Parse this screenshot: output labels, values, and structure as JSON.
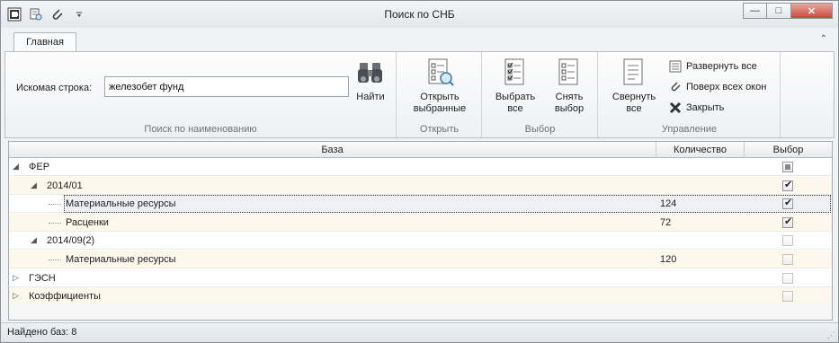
{
  "window": {
    "title": "Поиск по СНБ",
    "minimize_label": "—",
    "maximize_label": "□",
    "close_label": "✕"
  },
  "ribbon": {
    "tab_label": "Главная",
    "search_group": {
      "label": "Искомая строка:",
      "input_value": "железобет фунд",
      "find_label": "Найти",
      "group_label": "Поиск по наименованию"
    },
    "open_group": {
      "button_line1": "Открыть",
      "button_line2": "выбранные",
      "group_label": "Открыть"
    },
    "select_group": {
      "select_all_line1": "Выбрать",
      "select_all_line2": "все",
      "deselect_line1": "Снять",
      "deselect_line2": "выбор",
      "group_label": "Выбор"
    },
    "manage_group": {
      "collapse_line1": "Свернуть",
      "collapse_line2": "все",
      "expand_all": "Развернуть все",
      "on_top": "Поверх всех окон",
      "close": "Закрыть",
      "group_label": "Управление"
    }
  },
  "grid": {
    "columns": [
      "База",
      "Количество",
      "Выбор"
    ],
    "rows": [
      {
        "name": "ФЕР",
        "qty": "",
        "checked": "partial",
        "level": 0,
        "expanded": true
      },
      {
        "name": "2014/01",
        "qty": "",
        "checked": "on",
        "level": 1,
        "expanded": true
      },
      {
        "name": "Материальные ресурсы",
        "qty": "124",
        "checked": "on",
        "level": 2,
        "selected": true
      },
      {
        "name": "Расценки",
        "qty": "72",
        "checked": "on",
        "level": 2
      },
      {
        "name": "2014/09(2)",
        "qty": "",
        "checked": "off",
        "level": 1,
        "expanded": true
      },
      {
        "name": "Материальные ресурсы",
        "qty": "120",
        "checked": "off",
        "level": 2
      },
      {
        "name": "ГЭСН",
        "qty": "",
        "checked": "off",
        "level": 0,
        "expanded": false
      },
      {
        "name": "Коэффициенты",
        "qty": "",
        "checked": "off",
        "level": 0,
        "expanded": false
      }
    ]
  },
  "status": {
    "text": "Найдено баз: 8"
  },
  "colors": {
    "row_alt": "#fdf7ec",
    "accent_close": "#c7483a"
  }
}
